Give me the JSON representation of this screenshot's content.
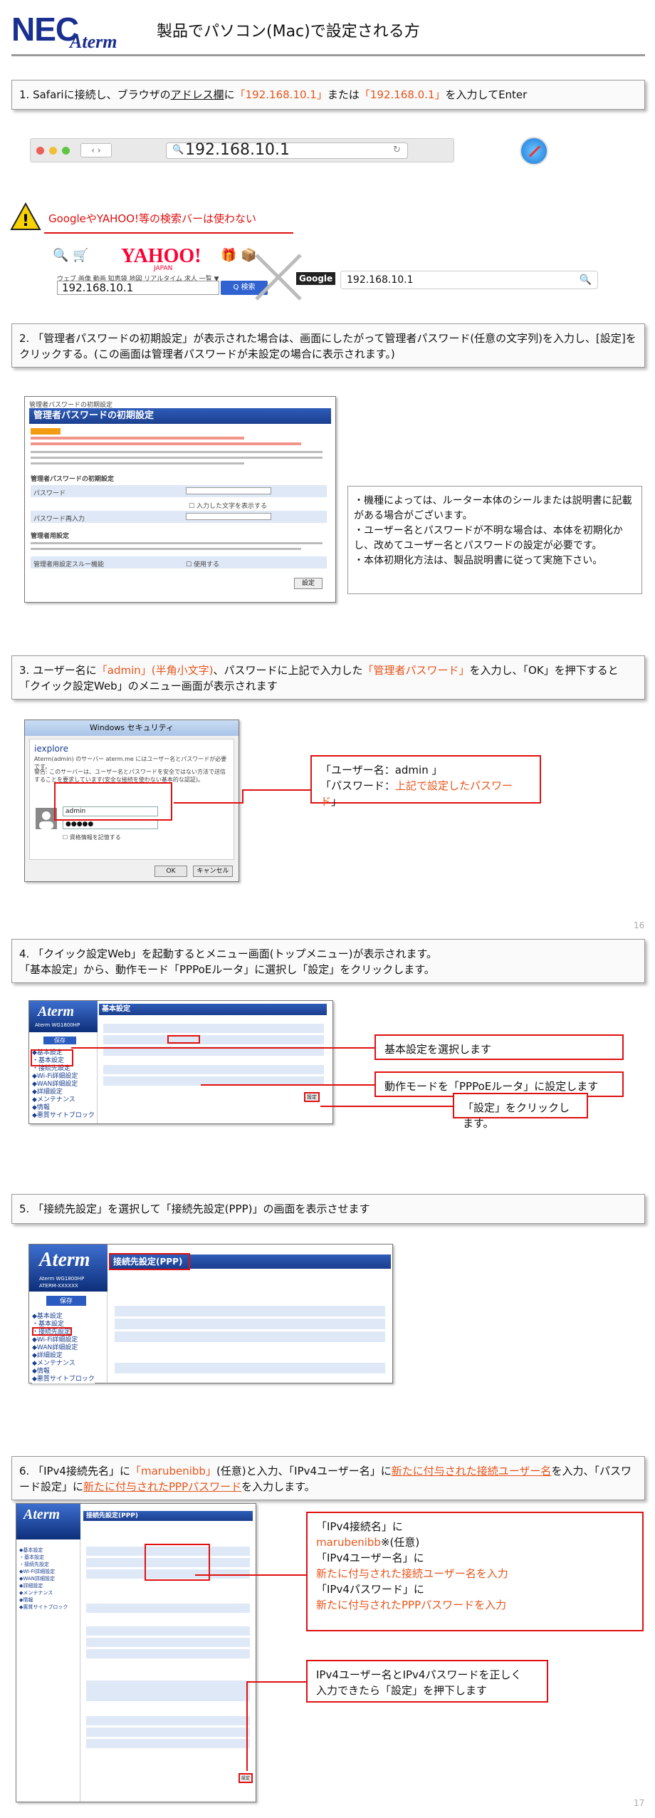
{
  "header": {
    "logo_nec": "NEC",
    "logo_aterm": "Aterm",
    "title": "製品でパソコン(Mac)で設定される方"
  },
  "step1": {
    "pre": "1.  Safariに接続し、ブラウザの",
    "addr": "アドレス欄",
    "mid1": "に",
    "ip1": "「192.168.10.1」",
    "mid2": "または",
    "ip2": "「192.168.0.1」",
    "post": "を入力してEnter"
  },
  "safari": {
    "url": "192.168.10.1"
  },
  "warning": {
    "text": "GoogleやYAHOO!等の検索バーは使わない"
  },
  "yahoo": {
    "logo": "YAHOO!",
    "sub": "JAPAN",
    "search_value": "192.168.10.1",
    "search_btn": "Q 検索",
    "google_logo": "Google",
    "google_value": "192.168.10.1"
  },
  "step2": {
    "text": "2. 「管理者パスワードの初期設定」が表示された場合は、画面にしたがって管理者パスワード(任意の文字列)を入力し、[設定]をクリックする。(この画面は管理者パスワードが未設定の場合に表示されます。)"
  },
  "pwinit": {
    "crumb": "管理者パスワードの初期設定",
    "title": "管理者パスワードの初期設定",
    "section1": "管理者パスワードの初期設定",
    "label_pw": "パスワード",
    "label_pw2": "パスワード再入力",
    "show_pw": "入力した文字を表示する",
    "section2": "管理者用設定",
    "label_dns": "管理者用設定スルー機能",
    "use": "使用する",
    "btn": "設定"
  },
  "note": {
    "lines": [
      "・機種によっては、ルーター本体のシールまたは説明書に記載がある場合がございます。",
      "・ユーザー名とパスワードが不明な場合は、本体を初期化かし、改めてユーザー名とパスワードの設定が必要です。",
      "・本体初期化方法は、製品説明書に従って実施下さい。"
    ]
  },
  "step3": {
    "pre": "3.  ユーザー名に",
    "user": "「admin」(半角小文字)",
    "mid": "、パスワードに上記で入力した",
    "pw": "「管理者パスワード」",
    "post": "を入力し、「OK」を押下すると「クイック設定Web」のメニュー画面が表示されます"
  },
  "dialog": {
    "title": "Windows セキュリティ",
    "app": "iexplore",
    "msg1": "Aterm(admin) のサーバー aterm.me にはユーザー名とパスワードが必要です。",
    "msg2": "警告: このサーバーは、ユーザー名とパスワードを安全ではない方法で送信することを要求しています(安全な接続を使わない基本的な認証)。",
    "user_value": "admin",
    "pw_value": "●●●●●",
    "remember": "資格情報を記憶する",
    "ok": "OK",
    "cancel": "キャンセル"
  },
  "callout3": {
    "l1_pre": "「ユーザー名：admin 」",
    "l2_pre": "「パスワード：",
    "l2_hl": "上記で設定したパスワード",
    "l2_post": "」"
  },
  "pagenum1": "16",
  "step4": {
    "l1": "4. 「クイック設定Web」を起動するとメニュー画面(トップメニュー)が表示されます。",
    "l2": "「基本設定」から、動作モード「PPPoEルータ」に選択し「設定」をクリックします。"
  },
  "router": {
    "brand": "Aterm",
    "model": "Aterm WG1800HP",
    "model2": "ATERM-XXXXXX",
    "save": "保存",
    "title4": "基本設定",
    "title5": "接続先設定(PPP)",
    "title6": "接続先設定(PPP)"
  },
  "callout4": {
    "a": "基本設定を選択します",
    "b": "動作モードを「PPPoEルータ」に設定します",
    "c": "「設定」をクリックします。"
  },
  "step5": {
    "text": "5. 「接続先設定」を選択して「接続先設定(PPP)」の画面を表示させます"
  },
  "step6": {
    "pre": "6. 「IPv4接続先名」に",
    "v1": "「marubenibb」",
    "mid": "(任意)と入力、「IPv4ユーザー名」に",
    "v2": "新たに付与された接続ユーザー名",
    "mid2": "を入力、「パスワード設定」に",
    "v3": "新たに付与されたPPPパスワード",
    "post": "を入力します。"
  },
  "callout6": {
    "l1": "「IPv4接続名」に",
    "l2": "marubenibb",
    "l2b": "※(任意)",
    "l3": "「IPv4ユーザー名」に",
    "l4": "新たに付与された接続ユーザー名を入力",
    "l5": "「IPv4パスワード」に",
    "l6": "新たに付与されたPPPパスワードを入力",
    "b1": "IPv4ユーザー名とIPv4パスワードを正しく",
    "b2": "入力できたら「設定」を押下します"
  },
  "pagenum2": "17",
  "colors": {
    "accent": "#e8541a",
    "red": "#e01010",
    "navy": "#1a2f8f"
  }
}
